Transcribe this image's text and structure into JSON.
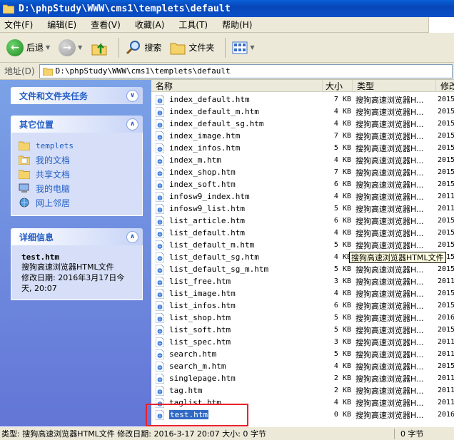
{
  "window": {
    "title": "D:\\phpStudy\\WWW\\cms1\\templets\\default"
  },
  "menu": [
    "文件(F)",
    "编辑(E)",
    "查看(V)",
    "收藏(A)",
    "工具(T)",
    "帮助(H)"
  ],
  "toolbar": {
    "back_label": "后退",
    "search_label": "搜索",
    "folders_label": "文件夹"
  },
  "address": {
    "label": "地址(D)",
    "path": "D:\\phpStudy\\WWW\\cms1\\templets\\default"
  },
  "tasks": {
    "file_tasks_title": "文件和文件夹任务",
    "other_places_title": "其它位置",
    "other_places": [
      "templets",
      "我的文档",
      "共享文档",
      "我的电脑",
      "网上邻居"
    ],
    "details_title": "详细信息",
    "details": {
      "name": "test.htm",
      "type": "搜狗高速浏览器HTML文件",
      "modified": "修改日期: 2016年3月17日今天, 20:07"
    }
  },
  "columns": {
    "name": "名称",
    "size": "大小",
    "type": "类型",
    "modified": "修改"
  },
  "files": [
    {
      "name": "index_default.htm",
      "size": "7 KB",
      "type": "搜狗高速浏览器H...",
      "modified": "2015"
    },
    {
      "name": "index_default_m.htm",
      "size": "4 KB",
      "type": "搜狗高速浏览器H...",
      "modified": "2015"
    },
    {
      "name": "index_default_sg.htm",
      "size": "4 KB",
      "type": "搜狗高速浏览器H...",
      "modified": "2015"
    },
    {
      "name": "index_image.htm",
      "size": "7 KB",
      "type": "搜狗高速浏览器H...",
      "modified": "2015"
    },
    {
      "name": "index_infos.htm",
      "size": "5 KB",
      "type": "搜狗高速浏览器H...",
      "modified": "2015"
    },
    {
      "name": "index_m.htm",
      "size": "4 KB",
      "type": "搜狗高速浏览器H...",
      "modified": "2015"
    },
    {
      "name": "index_shop.htm",
      "size": "7 KB",
      "type": "搜狗高速浏览器H...",
      "modified": "2015"
    },
    {
      "name": "index_soft.htm",
      "size": "6 KB",
      "type": "搜狗高速浏览器H...",
      "modified": "2015"
    },
    {
      "name": "infosw9_index.htm",
      "size": "4 KB",
      "type": "搜狗高速浏览器H...",
      "modified": "2011"
    },
    {
      "name": "infosw9_list.htm",
      "size": "5 KB",
      "type": "搜狗高速浏览器H...",
      "modified": "2011"
    },
    {
      "name": "list_article.htm",
      "size": "6 KB",
      "type": "搜狗高速浏览器H...",
      "modified": "2015"
    },
    {
      "name": "list_default.htm",
      "size": "4 KB",
      "type": "搜狗高速浏览器H...",
      "modified": "2015"
    },
    {
      "name": "list_default_m.htm",
      "size": "5 KB",
      "type": "搜狗高速浏览器H...",
      "modified": "2015"
    },
    {
      "name": "list_default_sg.htm",
      "size": "4 KB",
      "type": "搜狗高速浏览器H...",
      "modified": "2015"
    },
    {
      "name": "list_default_sg_m.htm",
      "size": "5 KB",
      "type": "搜狗高速浏览器H...",
      "modified": "2015"
    },
    {
      "name": "list_free.htm",
      "size": "3 KB",
      "type": "搜狗高速浏览器H...",
      "modified": "2011"
    },
    {
      "name": "list_image.htm",
      "size": "4 KB",
      "type": "搜狗高速浏览器H...",
      "modified": "2015"
    },
    {
      "name": "list_infos.htm",
      "size": "6 KB",
      "type": "搜狗高速浏览器H...",
      "modified": "2015"
    },
    {
      "name": "list_shop.htm",
      "size": "5 KB",
      "type": "搜狗高速浏览器H...",
      "modified": "2016"
    },
    {
      "name": "list_soft.htm",
      "size": "5 KB",
      "type": "搜狗高速浏览器H...",
      "modified": "2015"
    },
    {
      "name": "list_spec.htm",
      "size": "3 KB",
      "type": "搜狗高速浏览器H...",
      "modified": "2011"
    },
    {
      "name": "search.htm",
      "size": "5 KB",
      "type": "搜狗高速浏览器H...",
      "modified": "2011"
    },
    {
      "name": "search_m.htm",
      "size": "4 KB",
      "type": "搜狗高速浏览器H...",
      "modified": "2015"
    },
    {
      "name": "singlepage.htm",
      "size": "2 KB",
      "type": "搜狗高速浏览器H...",
      "modified": "2011"
    },
    {
      "name": "tag.htm",
      "size": "2 KB",
      "type": "搜狗高速浏览器H...",
      "modified": "2011"
    },
    {
      "name": "taglist.htm",
      "size": "4 KB",
      "type": "搜狗高速浏览器H...",
      "modified": "2011"
    },
    {
      "name": "test.htm",
      "size": "0 KB",
      "type": "搜狗高速浏览器H...",
      "modified": "2016",
      "selected": true
    }
  ],
  "tooltip": "搜狗高速浏览器HTML文件",
  "status": {
    "main": "类型: 搜狗高速浏览器HTML文件 修改日期: 2016-3-17 20:07 大小: 0 字节",
    "size": "0 字节"
  }
}
